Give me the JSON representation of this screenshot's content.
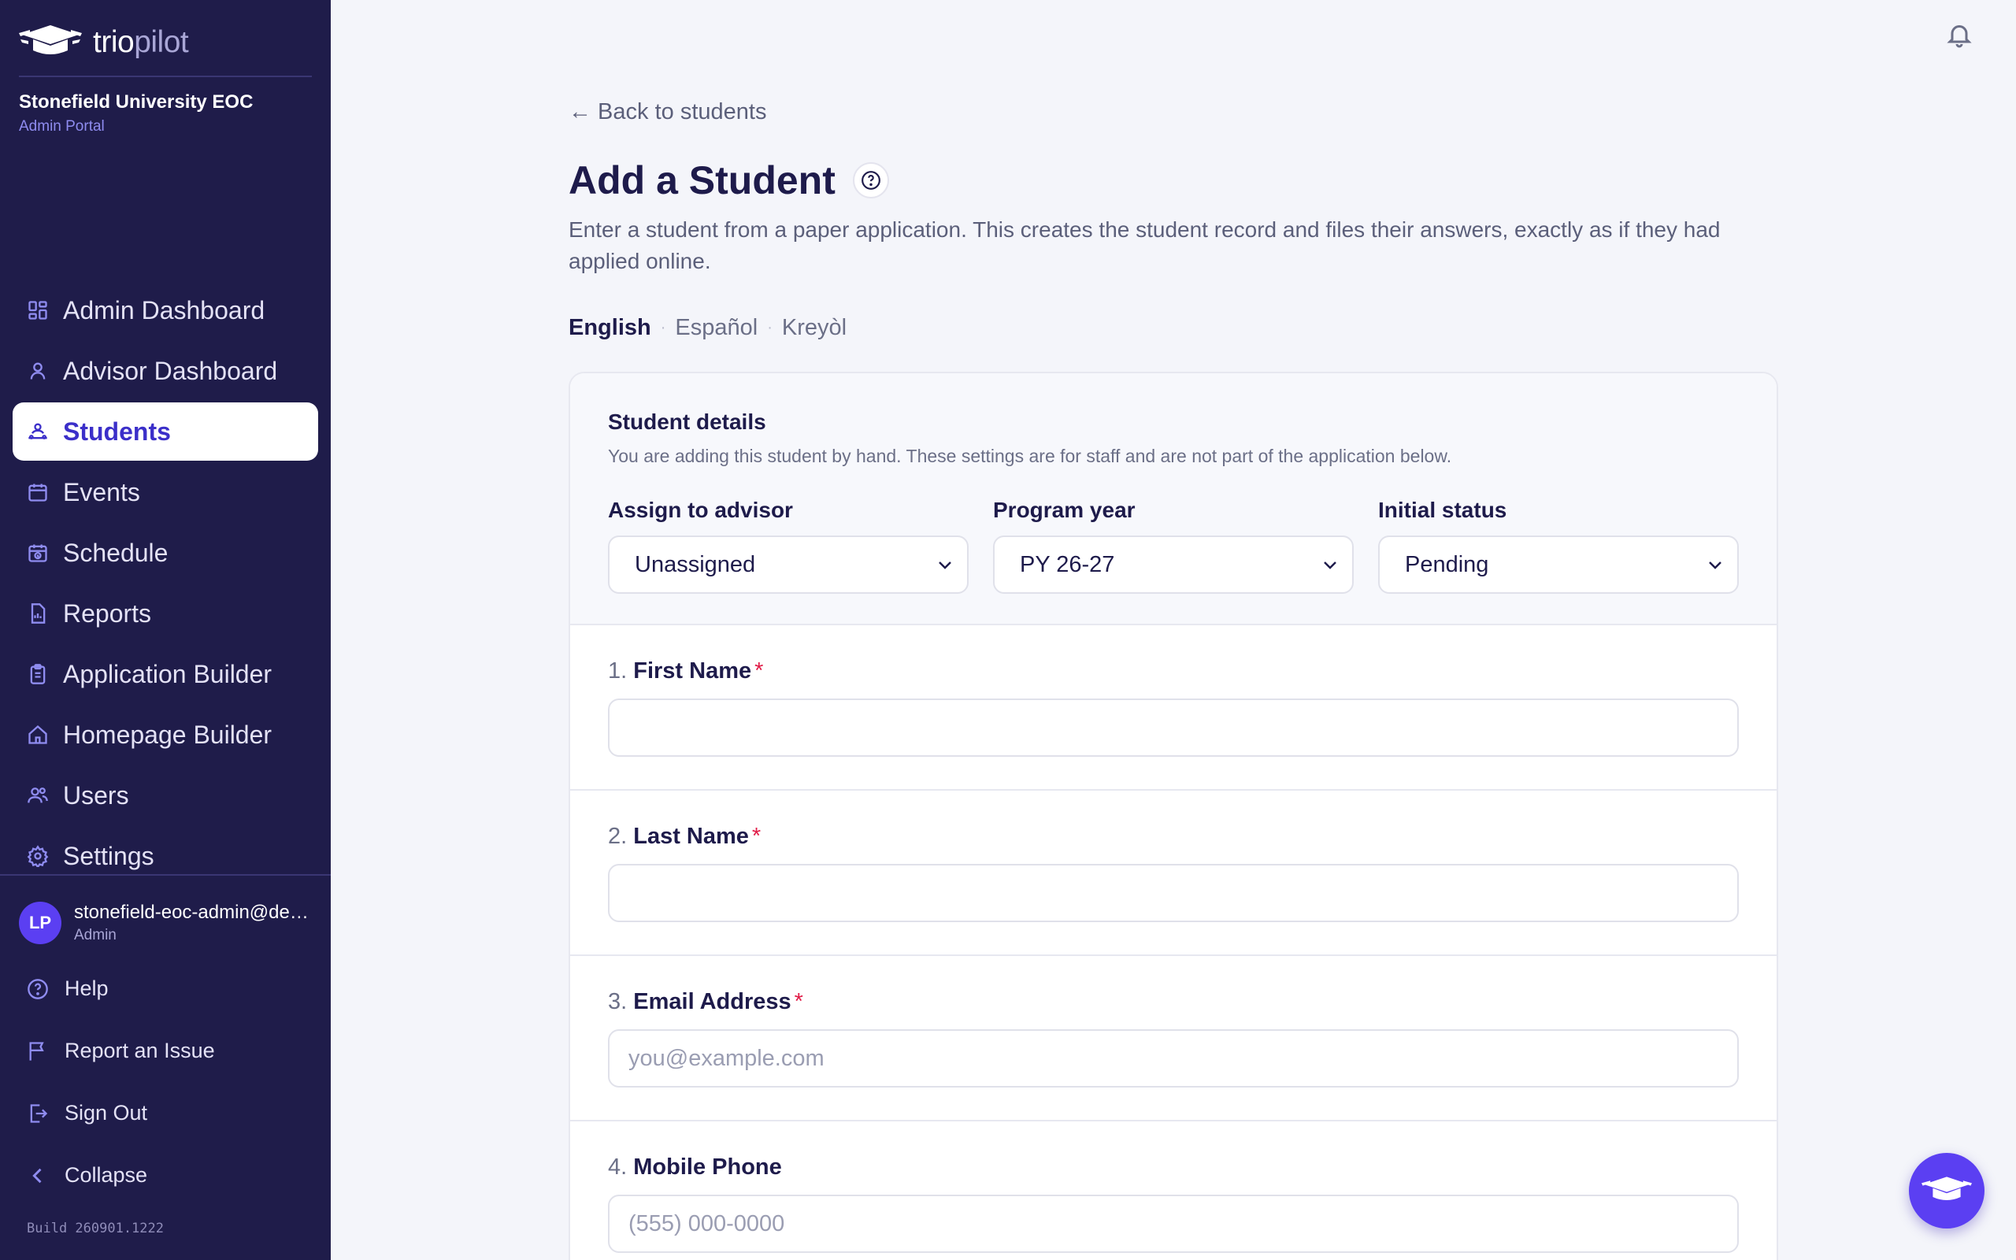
{
  "brand": {
    "name_part1": "trio",
    "name_part2": "pilot"
  },
  "org": {
    "name": "Stonefield University EOC",
    "portal": "Admin Portal"
  },
  "nav": {
    "items": [
      {
        "label": "Admin Dashboard",
        "icon": "dashboard-icon"
      },
      {
        "label": "Advisor Dashboard",
        "icon": "person-icon"
      },
      {
        "label": "Students",
        "icon": "students-icon",
        "active": true
      },
      {
        "label": "Events",
        "icon": "calendar-icon"
      },
      {
        "label": "Schedule",
        "icon": "schedule-icon"
      },
      {
        "label": "Reports",
        "icon": "report-icon"
      },
      {
        "label": "Application Builder",
        "icon": "clipboard-icon"
      },
      {
        "label": "Homepage Builder",
        "icon": "home-icon"
      },
      {
        "label": "Users",
        "icon": "users-icon"
      },
      {
        "label": "Settings",
        "icon": "gear-icon"
      }
    ]
  },
  "user": {
    "initials": "LP",
    "email": "stonefield-eoc-admin@demo.triopilot.com",
    "role": "Admin"
  },
  "footer_links": {
    "help": "Help",
    "report": "Report an Issue",
    "signout": "Sign Out",
    "collapse": "Collapse"
  },
  "build": "Build 260901.1222",
  "page": {
    "back": "← Back to students",
    "title": "Add a Student",
    "intro": "Enter a student from a paper application. This creates the student record and files their answers, exactly as if they had applied online.",
    "languages": {
      "current": "English",
      "es": "Español",
      "ht": "Kreyòl"
    }
  },
  "details": {
    "heading": "Student details",
    "note": "You are adding this student by hand. These settings are for staff and are not part of the application below.",
    "advisor": {
      "label": "Assign to advisor",
      "value": "Unassigned"
    },
    "program_year": {
      "label": "Program year",
      "value": "PY 26-27"
    },
    "status": {
      "label": "Initial status",
      "value": "Pending"
    }
  },
  "questions": [
    {
      "num": "1.",
      "label": "First Name",
      "required": "*",
      "placeholder": ""
    },
    {
      "num": "2.",
      "label": "Last Name",
      "required": "*",
      "placeholder": ""
    },
    {
      "num": "3.",
      "label": "Email Address",
      "required": "*",
      "placeholder": "you@example.com"
    },
    {
      "num": "4.",
      "label": "Mobile Phone",
      "required": "",
      "placeholder": "(555) 000-0000"
    }
  ],
  "colors": {
    "sidebar": "#1f1c4a",
    "accent": "#5b3ff2",
    "active_text": "#3b2fc9",
    "required": "#e11d48"
  }
}
